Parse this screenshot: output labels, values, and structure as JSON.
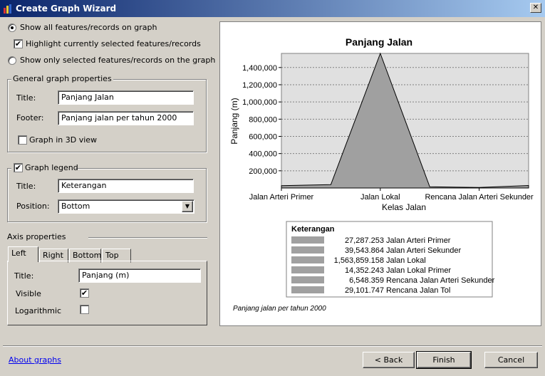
{
  "window": {
    "title": "Create Graph Wizard",
    "close": "✕"
  },
  "options": {
    "show_all": "Show all features/records on graph",
    "highlight": "Highlight currently selected features/records",
    "show_selected": "Show only selected features/records on the graph",
    "show_all_selected": true,
    "highlight_checked": true
  },
  "general": {
    "legend": "General graph properties",
    "title_label": "Title:",
    "title_value": "Panjang Jalan",
    "footer_label": "Footer:",
    "footer_value": "Panjang jalan per tahun 2000",
    "view3d_label": "Graph in 3D view",
    "view3d_checked": false
  },
  "graph_legend": {
    "legend": "Graph legend",
    "checked": true,
    "title_label": "Title:",
    "title_value": "Keterangan",
    "position_label": "Position:",
    "position_value": "Bottom"
  },
  "axis": {
    "heading": "Axis properties",
    "tabs": [
      "Left",
      "Right",
      "Bottom",
      "Top"
    ],
    "active_tab": "Left",
    "title_label": "Title:",
    "title_value": "Panjang (m)",
    "visible_label": "Visible",
    "visible_checked": true,
    "log_label": "Logarithmic",
    "log_checked": false
  },
  "footer": {
    "about": "About graphs",
    "back": "< Back",
    "finish": "Finish",
    "cancel": "Cancel"
  },
  "chart_data": {
    "type": "area",
    "title": "Panjang Jalan",
    "xlabel": "Kelas Jalan",
    "ylabel": "Panjang (m)",
    "footer": "Panjang jalan per tahun 2000",
    "categories": [
      "Jalan Arteri Primer",
      "Jalan Arteri Sekunder",
      "Jalan Lokal",
      "Jalan Lokal Primer",
      "Rencana Jalan Arteri Sekunder",
      "Rencana Jalan Tol"
    ],
    "shown_x_tick_labels": [
      "Jalan Arteri Primer",
      "Jalan Lokal",
      "Rencana Jalan Arteri Sekunder"
    ],
    "values": [
      27287.253,
      39543.864,
      1563859.158,
      14352.243,
      6548.359,
      29101.747
    ],
    "value_labels": [
      "27,287.253",
      "39,543.864",
      "1,563,859.158",
      "14,352.243",
      "6,548.359",
      "29,101.747"
    ],
    "y_ticks": [
      "200,000",
      "400,000",
      "600,000",
      "800,000",
      "1,000,000",
      "1,200,000",
      "1,400,000"
    ],
    "ylim": [
      0,
      1563859.158
    ],
    "grid": true,
    "legend": {
      "title": "Keterangan",
      "placement": "bottom"
    },
    "colors": {
      "area": "#a0a0a0",
      "plot_bg": "#e0e0e0",
      "swatch": "#a0a0a0"
    }
  }
}
